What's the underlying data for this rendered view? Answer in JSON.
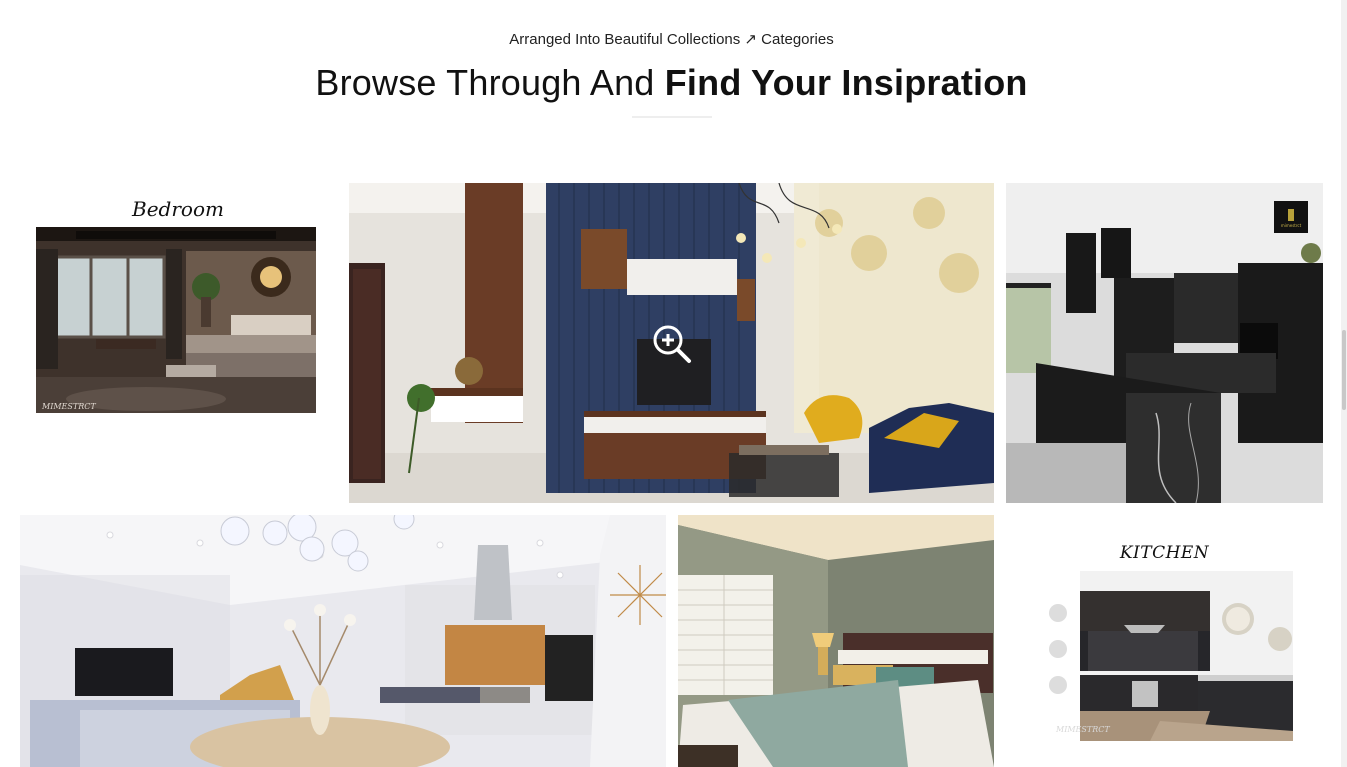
{
  "header": {
    "subtitle": "Arranged Into Beautiful Collections ↗ Categories",
    "headline_light": "Browse Through And ",
    "headline_bold": "Find Your Insipration"
  },
  "gallery": {
    "bedroom_board": {
      "title": "Bedroom",
      "watermark": "MIMESTRCT",
      "swatches": [
        "#574742",
        "#221a16",
        "#8a7b72",
        "#946a4c",
        "#e1c39f"
      ]
    },
    "kitchen_board": {
      "title": "KITCHEN",
      "watermark": "MIMESTRCT"
    },
    "living_room": {
      "overlay_icon": "zoom-in-icon"
    },
    "dark_kitchen": {
      "badge_text": "mimestrct"
    }
  }
}
